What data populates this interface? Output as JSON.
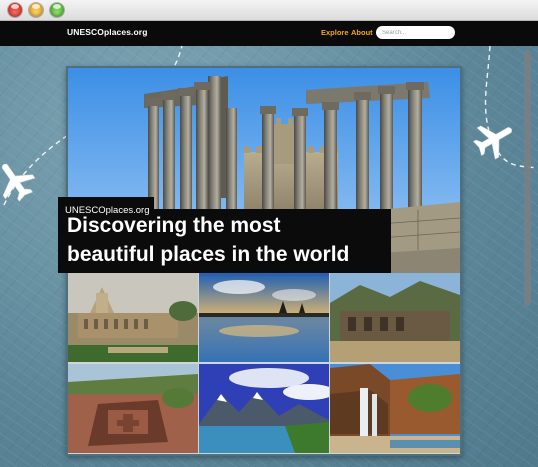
{
  "window": {
    "controls": [
      "close",
      "minimize",
      "zoom"
    ]
  },
  "nav": {
    "brand": "UNESCOplaces.org",
    "links": [
      {
        "label": "Explore"
      },
      {
        "label": "About"
      }
    ],
    "search_placeholder": "Search..."
  },
  "hero": {
    "site_label": "UNESCOplaces.org",
    "headline_line1": "Discovering the most",
    "headline_line2": "beautiful places in the world"
  },
  "colors": {
    "nav_background": "#0a0a0a",
    "nav_link": "#f2a51a",
    "page_background": "#5d8799"
  },
  "icons": [
    "airplane-icon",
    "airplane-icon"
  ]
}
